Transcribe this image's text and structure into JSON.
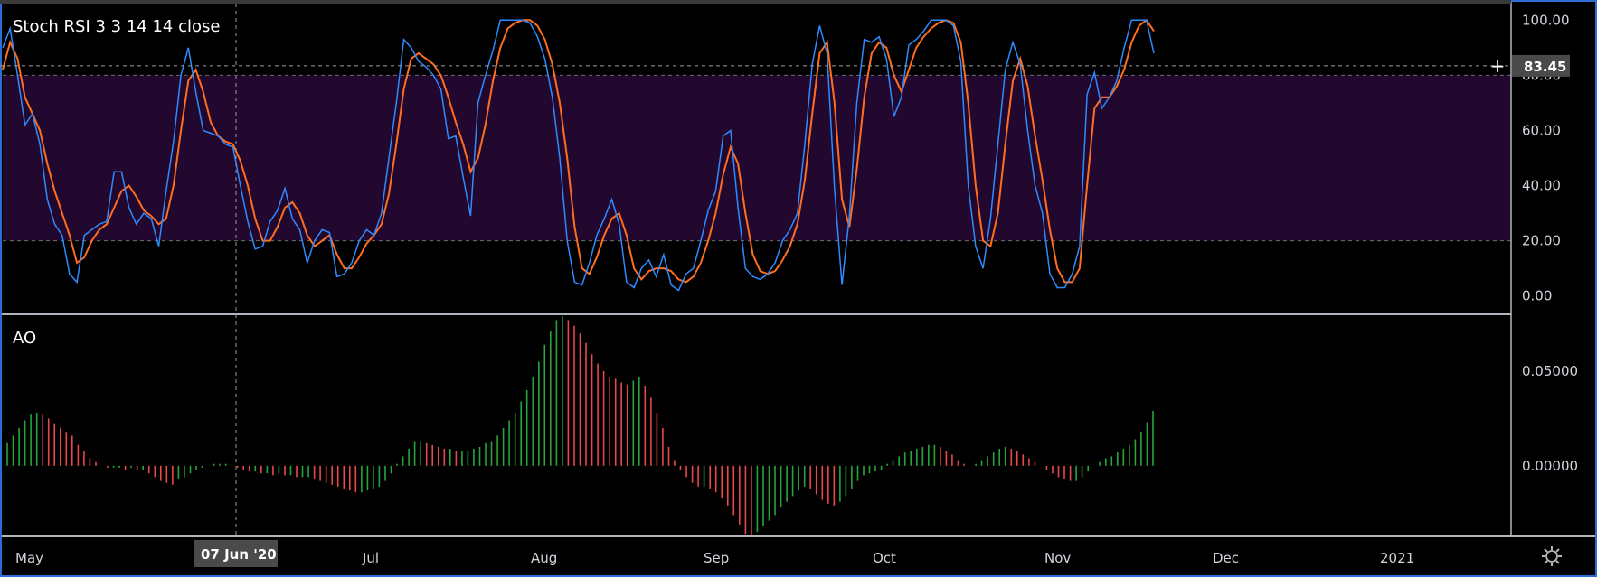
{
  "chart_data": [
    {
      "type": "line",
      "title": "Stoch RSI 3 3 14 14 close",
      "ylim": [
        -6,
        106
      ],
      "yticks": [
        "100.00",
        "80.00",
        "60.00",
        "40.00",
        "20.00",
        "0.00"
      ],
      "band": [
        20,
        80
      ],
      "price_label": "83.45",
      "price_value": 83.45,
      "colors": {
        "k": "#2e8bff",
        "d": "#ff6d1f",
        "band": "#22082f",
        "grid": "#6b6b6b"
      },
      "series": [
        {
          "values": [
            90,
            97,
            80,
            62,
            66,
            55,
            35,
            26,
            22,
            8,
            5,
            22,
            24,
            26,
            27,
            45,
            45,
            32,
            26,
            30,
            28,
            18,
            38,
            56,
            80,
            90,
            74,
            60,
            59,
            58,
            55,
            54,
            40,
            27,
            17,
            18,
            27,
            31,
            39,
            28,
            24,
            12,
            20,
            24,
            23,
            7,
            8,
            12,
            20,
            24,
            22,
            30,
            50,
            70,
            93,
            90,
            85,
            83,
            80,
            75,
            57,
            58,
            43,
            29,
            70,
            80,
            89,
            100,
            100,
            100,
            100,
            99,
            94,
            86,
            72,
            50,
            20,
            5,
            4,
            12,
            22,
            28,
            35,
            26,
            5,
            3,
            10,
            13,
            7,
            15,
            4,
            2,
            8,
            10,
            20,
            31,
            38,
            58,
            60,
            32,
            10,
            7,
            6,
            8,
            12,
            20,
            24,
            30,
            55,
            84,
            98,
            88,
            39,
            4,
            29,
            70,
            93,
            92,
            94,
            86,
            65,
            72,
            91,
            93,
            96,
            100,
            100,
            100,
            98,
            85,
            40,
            18,
            10,
            28,
            55,
            82,
            92,
            84,
            60,
            40,
            30,
            8,
            3,
            3,
            8,
            18,
            73,
            81,
            68,
            72,
            78,
            90,
            100,
            100,
            100,
            88
          ]
        },
        {
          "values": [
            82,
            92,
            86,
            72,
            66,
            60,
            48,
            38,
            30,
            22,
            12,
            14,
            20,
            24,
            26,
            32,
            38,
            40,
            36,
            31,
            29,
            26,
            28,
            40,
            60,
            78,
            82,
            74,
            63,
            58,
            56,
            55,
            49,
            40,
            28,
            20,
            20,
            25,
            32,
            34,
            30,
            22,
            18,
            20,
            22,
            15,
            10,
            10,
            14,
            19,
            22,
            26,
            37,
            55,
            75,
            86,
            88,
            86,
            84,
            80,
            72,
            63,
            55,
            45,
            50,
            62,
            78,
            90,
            97,
            99,
            100,
            100,
            98,
            93,
            84,
            70,
            50,
            25,
            10,
            8,
            14,
            22,
            28,
            30,
            22,
            10,
            6,
            9,
            10,
            10,
            9,
            6,
            5,
            7,
            12,
            20,
            30,
            44,
            54,
            48,
            30,
            15,
            9,
            8,
            9,
            13,
            18,
            26,
            42,
            66,
            88,
            92,
            70,
            35,
            25,
            46,
            72,
            88,
            92,
            90,
            80,
            74,
            82,
            90,
            94,
            97,
            99,
            100,
            99,
            92,
            70,
            40,
            20,
            18,
            30,
            55,
            78,
            86,
            76,
            58,
            42,
            24,
            10,
            5,
            5,
            10,
            40,
            68,
            72,
            72,
            76,
            82,
            92,
            98,
            100,
            96
          ]
        }
      ]
    },
    {
      "type": "bar",
      "title": "AO",
      "ylim": [
        -0.0368,
        0.0791
      ],
      "yticks": [
        "0.05000",
        "0.00000"
      ],
      "colors": {
        "up": "#26a63a",
        "down": "#e84848",
        "grid": "#6b6b6b"
      },
      "values": [
        0.012,
        0.016,
        0.02,
        0.024,
        0.027,
        0.028,
        0.027,
        0.025,
        0.022,
        0.02,
        0.018,
        0.016,
        0.011,
        0.008,
        0.004,
        0.002,
        0,
        -0.001,
        -0.001,
        -0.001,
        -0.002,
        -0.001,
        -0.002,
        -0.002,
        -0.004,
        -0.006,
        -0.008,
        -0.009,
        -0.01,
        -0.007,
        -0.006,
        -0.004,
        -0.002,
        -0.001,
        0,
        0.001,
        0.001,
        0.001,
        0,
        -0.001,
        -0.002,
        -0.003,
        -0.003,
        -0.004,
        -0.004,
        -0.005,
        -0.004,
        -0.005,
        -0.005,
        -0.006,
        -0.006,
        -0.006,
        -0.007,
        -0.008,
        -0.009,
        -0.01,
        -0.011,
        -0.012,
        -0.013,
        -0.014,
        -0.014,
        -0.013,
        -0.012,
        -0.011,
        -0.008,
        -0.004,
        0.001,
        0.005,
        0.009,
        0.013,
        0.013,
        0.012,
        0.011,
        0.01,
        0.009,
        0.009,
        0.008,
        0.008,
        0.008,
        0.009,
        0.01,
        0.012,
        0.013,
        0.016,
        0.02,
        0.024,
        0.028,
        0.034,
        0.04,
        0.047,
        0.055,
        0.064,
        0.071,
        0.077,
        0.079,
        0.077,
        0.074,
        0.07,
        0.065,
        0.059,
        0.054,
        0.05,
        0.047,
        0.046,
        0.044,
        0.043,
        0.045,
        0.047,
        0.042,
        0.036,
        0.028,
        0.02,
        0.01,
        0.003,
        -0.002,
        -0.006,
        -0.009,
        -0.011,
        -0.011,
        -0.012,
        -0.014,
        -0.017,
        -0.021,
        -0.026,
        -0.031,
        -0.036,
        -0.037,
        -0.035,
        -0.032,
        -0.029,
        -0.026,
        -0.022,
        -0.019,
        -0.016,
        -0.013,
        -0.011,
        -0.012,
        -0.015,
        -0.018,
        -0.02,
        -0.021,
        -0.019,
        -0.016,
        -0.012,
        -0.008,
        -0.005,
        -0.004,
        -0.003,
        -0.002,
        0.001,
        0.003,
        0.005,
        0.007,
        0.008,
        0.009,
        0.01,
        0.011,
        0.011,
        0.01,
        0.008,
        0.006,
        0.003,
        0.001,
        0,
        0.001,
        0.003,
        0.005,
        0.007,
        0.009,
        0.01,
        0.009,
        0.008,
        0.006,
        0.004,
        0.002,
        0,
        -0.002,
        -0.004,
        -0.006,
        -0.007,
        -0.008,
        -0.008,
        -0.006,
        -0.003,
        0,
        0.002,
        0.004,
        0.005,
        0.007,
        0.009,
        0.011,
        0.014,
        0.018,
        0.023,
        0.029
      ]
    }
  ],
  "x_axis": {
    "labels": [
      "May",
      "Jul",
      "Aug",
      "Sep",
      "Oct",
      "Nov",
      "Dec",
      "2021"
    ],
    "crosshair_label": "07 Jun '20"
  }
}
